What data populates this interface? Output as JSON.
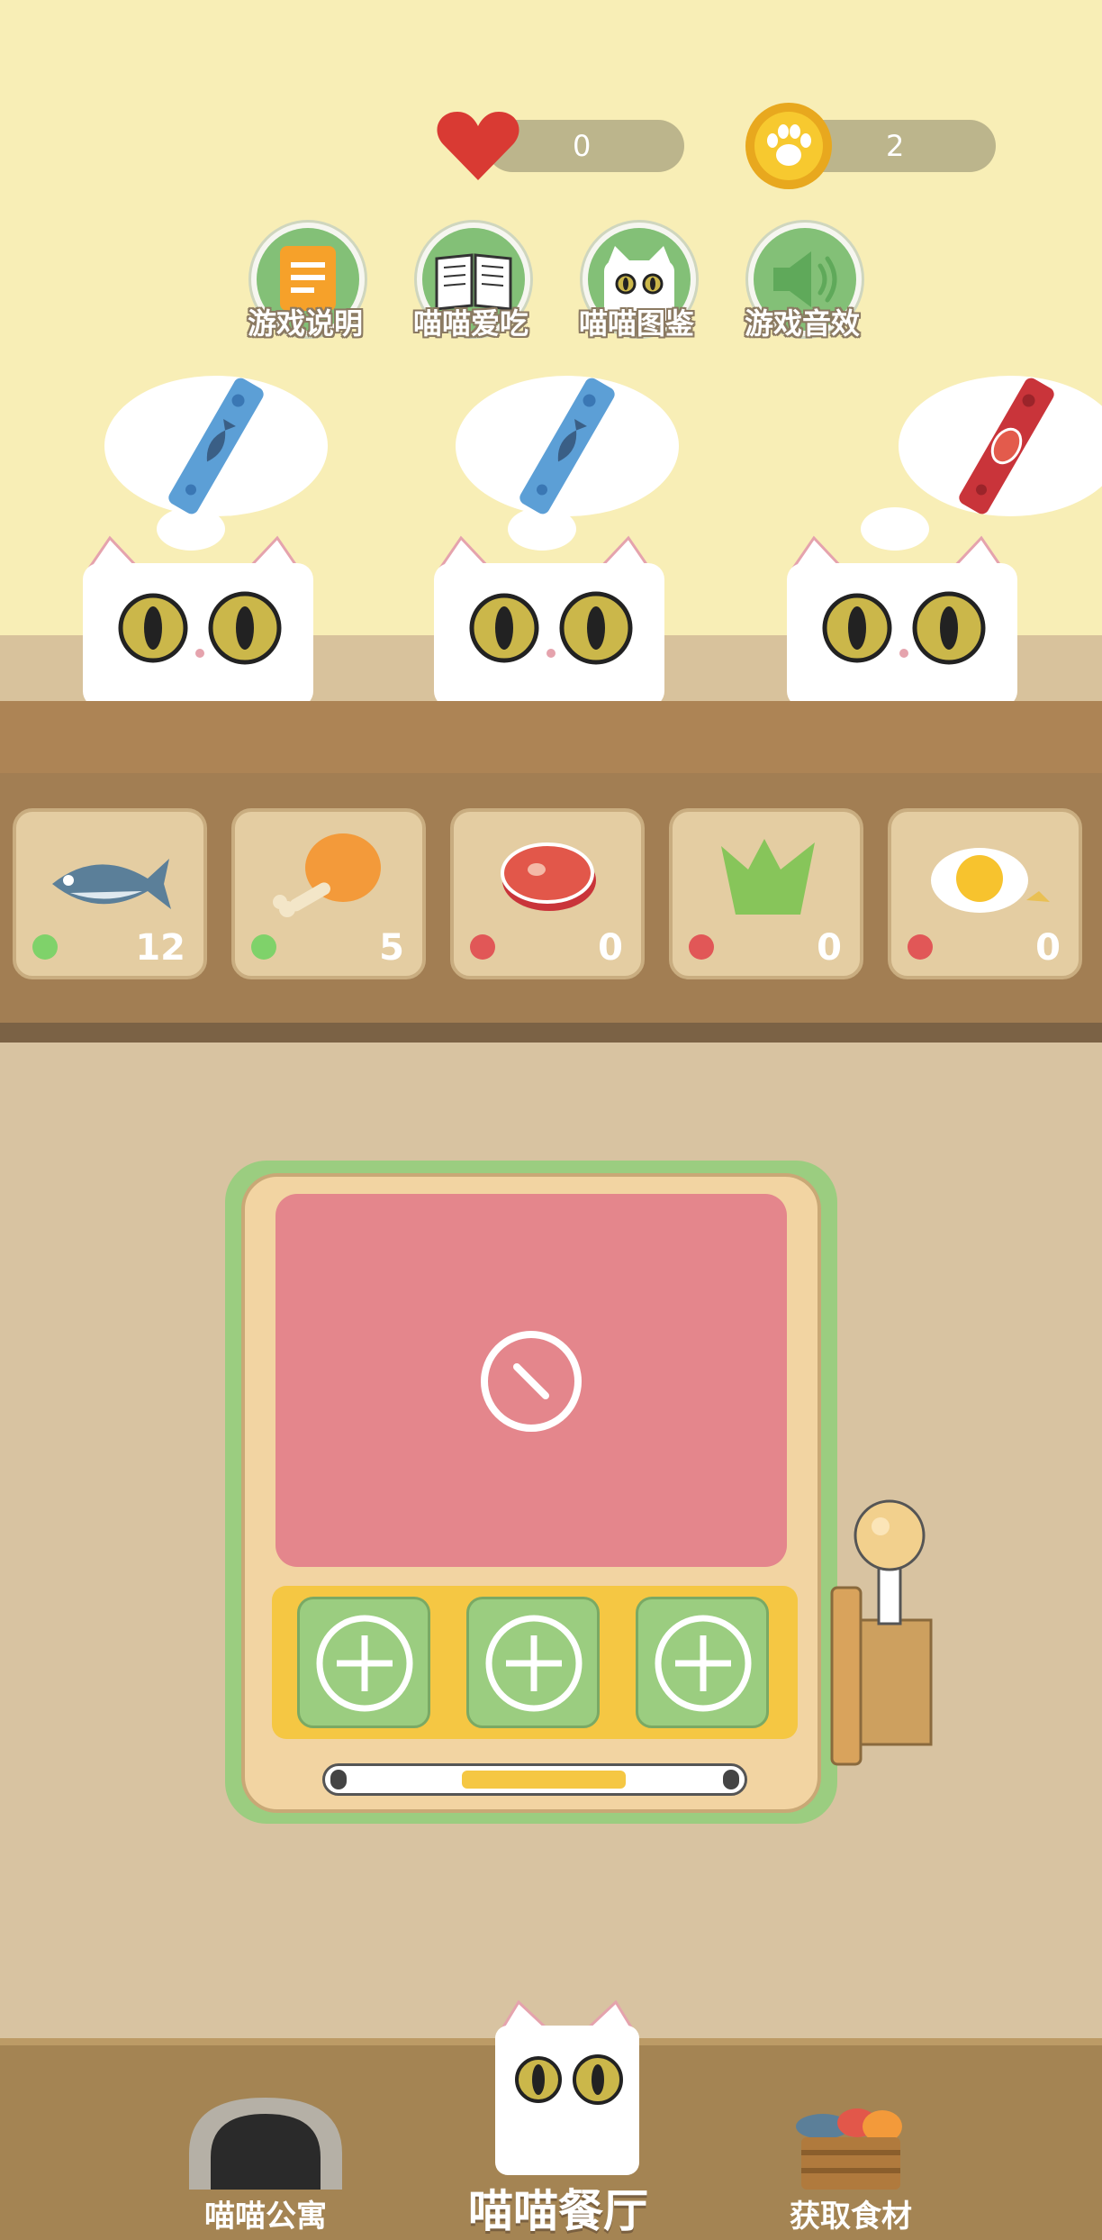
{
  "stats": {
    "hearts": "0",
    "paws": "2"
  },
  "menu": [
    {
      "label": "游戏说明",
      "icon": "list-icon"
    },
    {
      "label": "喵喵爱吃",
      "icon": "book-icon"
    },
    {
      "label": "喵喵图鉴",
      "icon": "cat-face-icon"
    },
    {
      "label": "游戏音效",
      "icon": "speaker-icon"
    }
  ],
  "cats": [
    {
      "wants": "fish-stick-icon",
      "color": "#5c9fd6"
    },
    {
      "wants": "fish-stick-icon",
      "color": "#5c9fd6"
    },
    {
      "wants": "meat-stick-icon",
      "color": "#c9343a"
    }
  ],
  "ingredients": [
    {
      "name": "fish",
      "count": "12",
      "available": true
    },
    {
      "name": "chicken-leg",
      "count": "5",
      "available": true
    },
    {
      "name": "steak",
      "count": "0",
      "available": false
    },
    {
      "name": "greens",
      "count": "0",
      "available": false
    },
    {
      "name": "egg",
      "count": "0",
      "available": false
    }
  ],
  "machine": {
    "progress": 0.45
  },
  "nav": [
    {
      "label": "喵喵公寓",
      "icon": "apartment-icon"
    },
    {
      "label": "喵喵餐厅",
      "icon": "cat-restaurant-icon",
      "active": true
    },
    {
      "label": "获取食材",
      "icon": "food-basket-icon"
    }
  ],
  "colors": {
    "wall": "#f8eeb6",
    "counter": "#a27e53",
    "screen": "#e4868c",
    "green": "#9bcd80",
    "gold": "#f5c743"
  }
}
